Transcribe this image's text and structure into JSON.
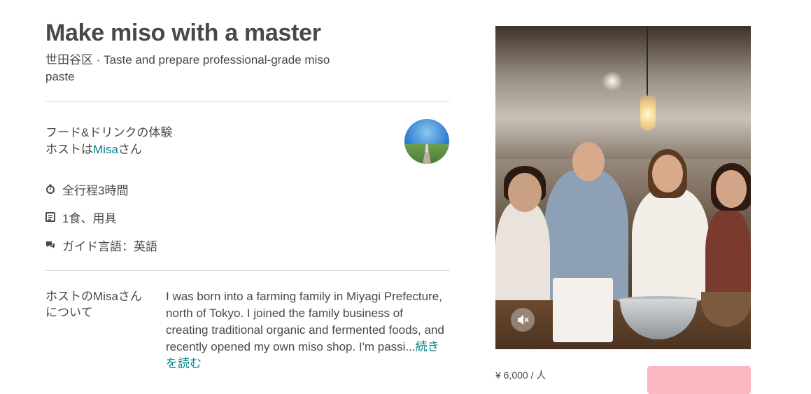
{
  "experience": {
    "title": "Make miso with a master",
    "subtitle": "世田谷区 · Taste and prepare professional-grade miso paste",
    "category": "フード&ドリンクの体験",
    "host_prefix": "ホストは",
    "host_name": "Misa",
    "host_suffix": "さん"
  },
  "facts": [
    {
      "icon": "clock-icon",
      "text": "全行程3時間"
    },
    {
      "icon": "menu-icon",
      "text": "1食、用具"
    },
    {
      "icon": "chat-icon",
      "text": "ガイド言語：英語"
    }
  ],
  "about": {
    "heading": "ホストのMisaさんについて",
    "text": "I was born into a farming family in Miyagi Prefecture, north of Tokyo. I joined the family business of creating traditional organic and fermented foods, and recently opened my own miso shop. I'm passi...",
    "read_more": "続きを読む"
  },
  "media": {
    "mute_icon": "speaker-mute-icon"
  },
  "booking": {
    "price_text": "¥ 6,000 / 人",
    "button_label": ""
  },
  "colors": {
    "text": "#484848",
    "link": "#008489",
    "divider": "#dcdcdc",
    "button": "#fbb8c0"
  }
}
